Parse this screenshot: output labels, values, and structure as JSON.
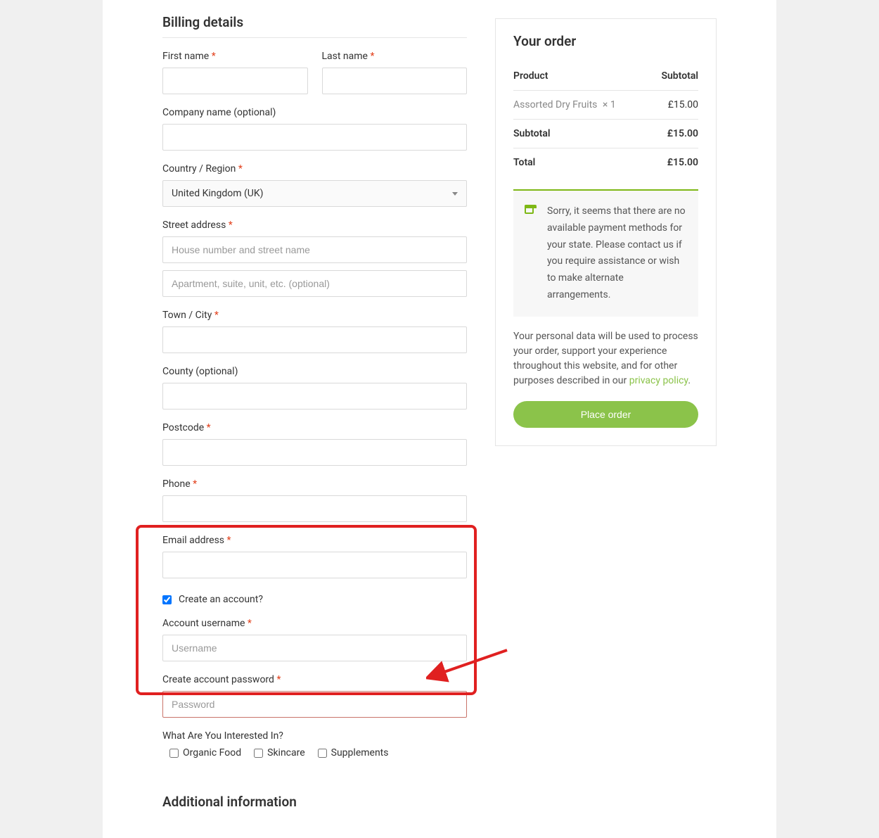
{
  "billing": {
    "title": "Billing details",
    "first_name_label": "First name",
    "last_name_label": "Last name",
    "company_label": "Company name (optional)",
    "country_label": "Country / Region",
    "country_value": "United Kingdom (UK)",
    "street_label": "Street address",
    "street_placeholder": "House number and street name",
    "street2_placeholder": "Apartment, suite, unit, etc. (optional)",
    "city_label": "Town / City",
    "county_label": "County (optional)",
    "postcode_label": "Postcode",
    "phone_label": "Phone",
    "email_label": "Email address",
    "required_mark": "*"
  },
  "account": {
    "create_label": "Create an account?",
    "username_label": "Account username",
    "username_placeholder": "Username",
    "password_label": "Create account password",
    "password_placeholder": "Password",
    "interests_label": "What Are You Interested In?",
    "interests": [
      "Organic Food",
      "Skincare",
      "Supplements"
    ]
  },
  "additional": {
    "title": "Additional information"
  },
  "order": {
    "title": "Your order",
    "product_header": "Product",
    "subtotal_header": "Subtotal",
    "item_name": "Assorted Dry Fruits",
    "item_qty": "× 1",
    "item_price": "£15.00",
    "subtotal_label": "Subtotal",
    "subtotal_value": "£15.00",
    "total_label": "Total",
    "total_value": "£15.00",
    "notice": "Sorry, it seems that there are no available payment methods for your state. Please contact us if you require assistance or wish to make alternate arrangements.",
    "privacy_text_1": "Your personal data will be used to process your order, support your experience throughout this website, and for other purposes described in our ",
    "privacy_link": "privacy policy",
    "privacy_text_2": ".",
    "place_order_label": "Place order"
  }
}
